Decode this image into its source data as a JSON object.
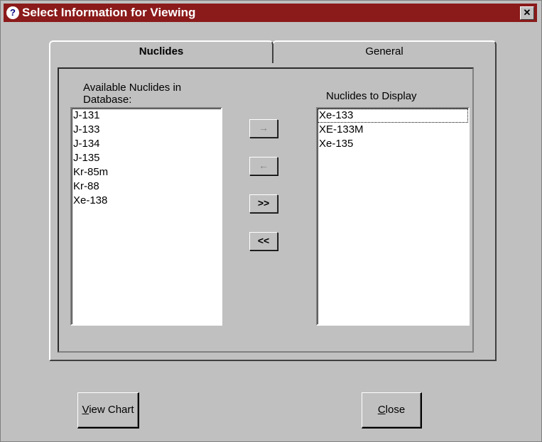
{
  "window": {
    "title": "Select Information for Viewing",
    "help_icon": "question-icon",
    "close_glyph": "✕"
  },
  "tabs": [
    {
      "label": "Nuclides",
      "active": true
    },
    {
      "label": "General",
      "active": false
    }
  ],
  "available": {
    "label": "Available Nuclides in Database:",
    "items": [
      "J-131",
      "J-133",
      "J-134",
      "J-135",
      "Kr-85m",
      "Kr-88",
      "Xe-138"
    ]
  },
  "display": {
    "label": "Nuclides to Display",
    "items": [
      "Xe-133",
      "XE-133M",
      "Xe-135"
    ]
  },
  "move_buttons": {
    "add": "→",
    "remove": "←",
    "add_all": ">>",
    "remove_all": "<<"
  },
  "actions": {
    "view_chart": {
      "mnemonic": "V",
      "rest": "iew Chart"
    },
    "close": {
      "mnemonic": "C",
      "rest": "lose"
    }
  }
}
